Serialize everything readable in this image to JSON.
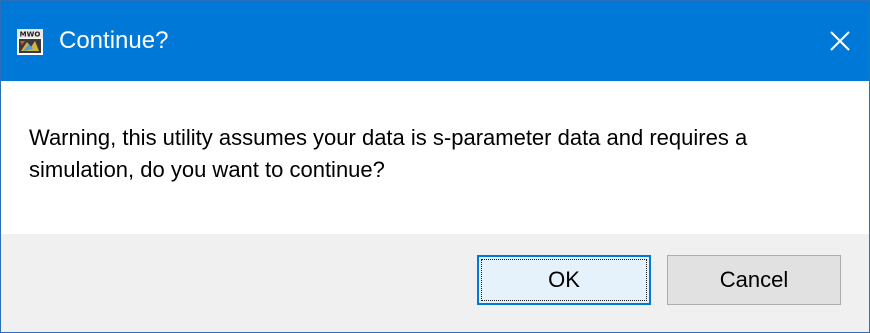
{
  "window": {
    "title": "Continue?",
    "icon": "awr-app-icon",
    "close_icon": "close-icon"
  },
  "message": {
    "text": "Warning, this utility assumes your data is s-parameter data and requires a simulation, do you want to continue?"
  },
  "buttons": {
    "ok_label": "OK",
    "cancel_label": "Cancel"
  },
  "colors": {
    "titlebar": "#0078d7",
    "footer": "#f0f0f0",
    "button_face": "#e1e1e1",
    "default_button_border": "#0078d7"
  }
}
